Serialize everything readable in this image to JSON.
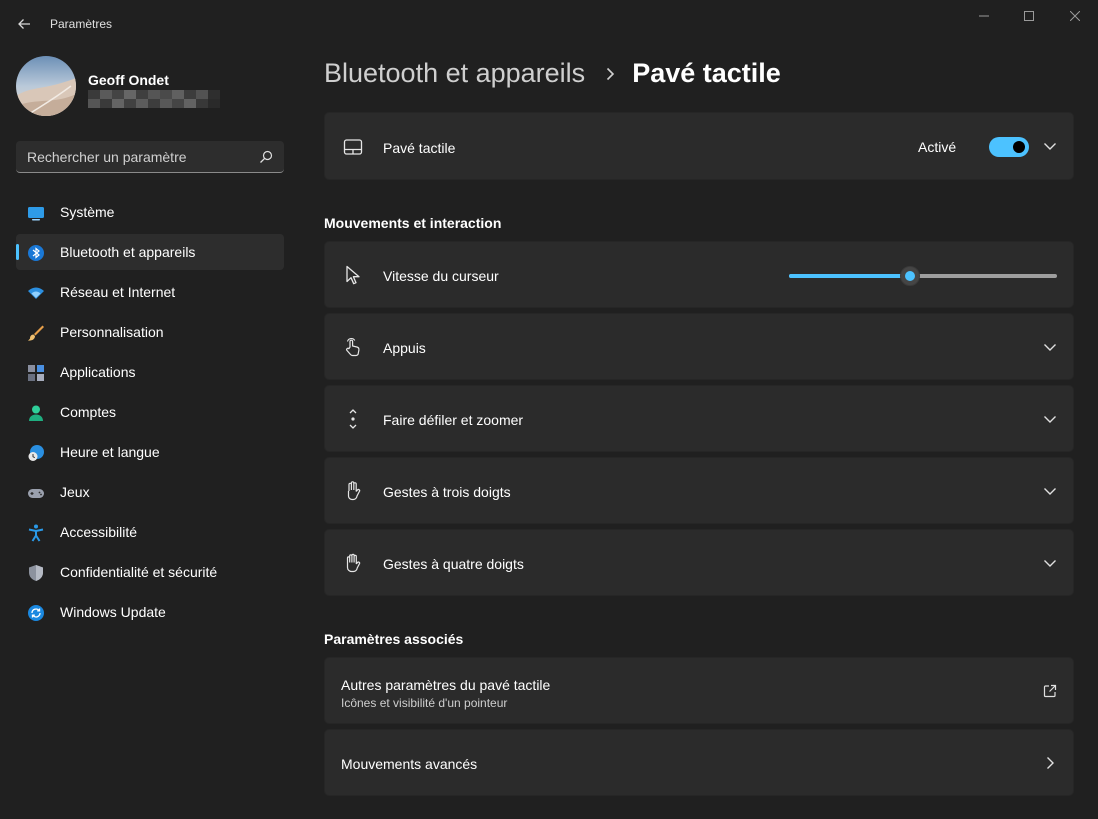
{
  "window": {
    "title": "Paramètres"
  },
  "user": {
    "name": "Geoff Ondet"
  },
  "search": {
    "placeholder": "Rechercher un paramètre"
  },
  "sidebar": {
    "items": [
      {
        "label": "Système",
        "icon": "system-icon",
        "active": false
      },
      {
        "label": "Bluetooth et appareils",
        "icon": "bluetooth-icon",
        "active": true
      },
      {
        "label": "Réseau et Internet",
        "icon": "wifi-icon",
        "active": false
      },
      {
        "label": "Personnalisation",
        "icon": "brush-icon",
        "active": false
      },
      {
        "label": "Applications",
        "icon": "apps-icon",
        "active": false
      },
      {
        "label": "Comptes",
        "icon": "account-icon",
        "active": false
      },
      {
        "label": "Heure et langue",
        "icon": "time-language-icon",
        "active": false
      },
      {
        "label": "Jeux",
        "icon": "gamepad-icon",
        "active": false
      },
      {
        "label": "Accessibilité",
        "icon": "accessibility-icon",
        "active": false
      },
      {
        "label": "Confidentialité et sécurité",
        "icon": "shield-icon",
        "active": false
      },
      {
        "label": "Windows Update",
        "icon": "update-icon",
        "active": false
      }
    ]
  },
  "breadcrumb": {
    "parent": "Bluetooth et appareils",
    "current": "Pavé tactile"
  },
  "touchpad": {
    "label": "Pavé tactile",
    "state_label": "Activé",
    "enabled": true
  },
  "sections": {
    "gestures": "Mouvements et interaction",
    "related": "Paramètres associés"
  },
  "settings": {
    "cursor_speed": {
      "label": "Vitesse du curseur",
      "value_fraction": 0.45
    },
    "taps": {
      "label": "Appuis"
    },
    "scroll_zoom": {
      "label": "Faire défiler et zoomer"
    },
    "three_finger": {
      "label": "Gestes à trois doigts"
    },
    "four_finger": {
      "label": "Gestes à quatre doigts"
    }
  },
  "related": {
    "more_touchpad": {
      "title": "Autres paramètres du pavé tactile",
      "subtitle": "Icônes et visibilité d'un pointeur"
    },
    "advanced_gestures": {
      "title": "Mouvements avancés"
    }
  },
  "colors": {
    "accent": "#4cc2ff",
    "background": "#202020",
    "card": "#2b2b2b"
  }
}
